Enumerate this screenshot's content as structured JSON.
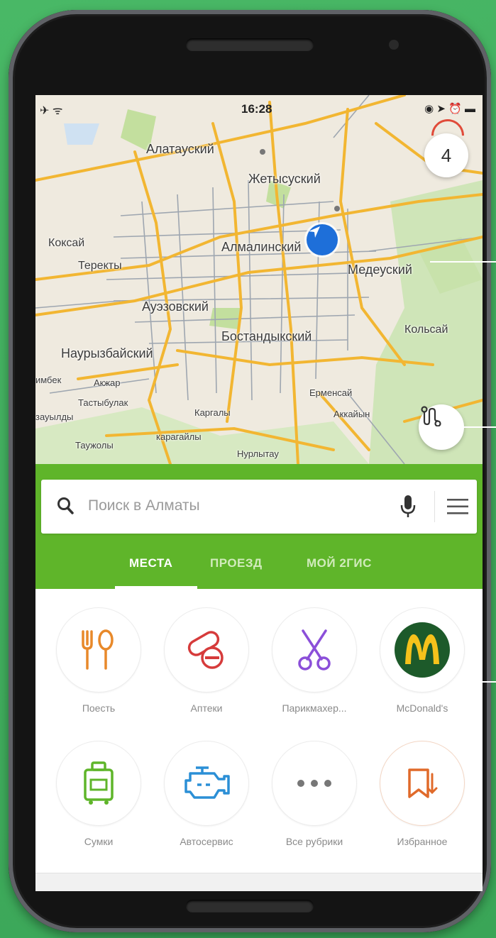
{
  "status": {
    "time": "16:28",
    "left_icons": "✈ ᯤ",
    "right_icons": "◉ ➤ ⏰ ▬"
  },
  "map": {
    "badge": "4",
    "labels": {
      "alatau": "Алатауский",
      "zhetysu": "Жетысуский",
      "koksai": "Коксай",
      "terekty": "Теректы",
      "almaly": "Алмалинский",
      "medeu": "Медеуский",
      "auezov": "Ауэзовский",
      "bostandyk": "Бостандыкский",
      "kolsai": "Кольсай",
      "nauryzbai": "Наурызбайский",
      "akzhar": "Акжар",
      "shibek": "имбек",
      "tastybulak": "Тастыбулак",
      "ermensai": "Ерменсай",
      "akkaiyn": "Аккайын",
      "ayuldy": "зауылды",
      "kargaly": "Каргалы",
      "karagaily": "карагайлы",
      "tauzholy": "Таужолы",
      "nurlytau": "Нурлытау"
    }
  },
  "search": {
    "placeholder": "Поиск в Алматы"
  },
  "tabs": [
    "МЕСТА",
    "ПРОЕЗД",
    "МОЙ 2ГИС"
  ],
  "categories": [
    {
      "label": "Поесть",
      "icon": "fork-spoon-icon",
      "color": "#e8892a"
    },
    {
      "label": "Аптеки",
      "icon": "pills-icon",
      "color": "#d63b3b"
    },
    {
      "label": "Парикмахер...",
      "icon": "scissors-icon",
      "color": "#8b4fd9"
    },
    {
      "label": "McDonald's",
      "icon": "mcdonalds-logo",
      "color": "#1d5a2a"
    },
    {
      "label": "Сумки",
      "icon": "suitcase-icon",
      "color": "#5fb52a"
    },
    {
      "label": "Автосервис",
      "icon": "engine-icon",
      "color": "#2b8fd6"
    },
    {
      "label": "Все рубрики",
      "icon": "more-dots-icon",
      "color": "#777777"
    },
    {
      "label": "Избранное",
      "icon": "bookmark-icon",
      "color": "#e06a2a"
    }
  ],
  "colors": {
    "green": "#5fb52a",
    "accent_blue": "#1e6fd9"
  }
}
